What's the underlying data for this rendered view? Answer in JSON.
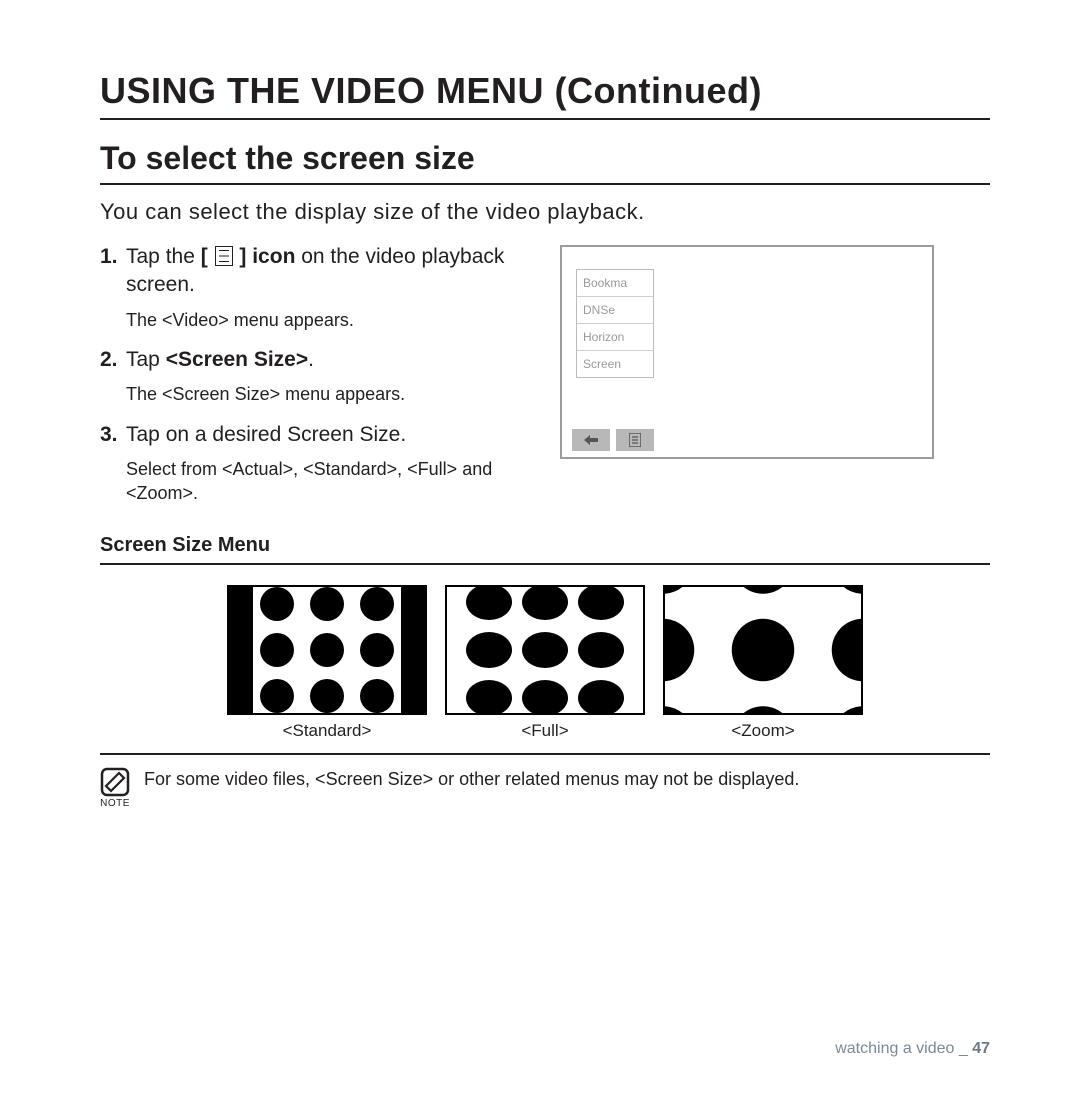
{
  "title": "USING THE VIDEO MENU (Continued)",
  "subtitle": "To select the screen size",
  "intro": "You can select the display size of the video playback.",
  "steps": {
    "s1": {
      "num": "1.",
      "pre": "Tap the ",
      "icon_label": "[ ",
      "icon_label_close": " ] icon",
      "post": " on the video playback screen."
    },
    "s1_sub": "The <Video> menu appears.",
    "s2": {
      "num": "2.",
      "pre": "Tap ",
      "bold": "<Screen Size>",
      "post": "."
    },
    "s2_sub": "The <Screen Size> menu appears.",
    "s3": {
      "num": "3.",
      "text": "Tap on a desired Screen Size."
    },
    "s3_sub": "Select from <Actual>, <Standard>, <Full> and <Zoom>."
  },
  "device_menu": {
    "items": [
      "Bookma",
      "DNSe",
      "Horizon",
      "Screen"
    ]
  },
  "section_label": "Screen Size Menu",
  "thumbs": {
    "standard": "<Standard>",
    "full": "<Full>",
    "zoom": "<Zoom>"
  },
  "note": {
    "label": "NOTE",
    "text": "For some video files, <Screen Size> or other related menus may not be displayed."
  },
  "footer": {
    "section": "watching a video _ ",
    "page": "47"
  }
}
